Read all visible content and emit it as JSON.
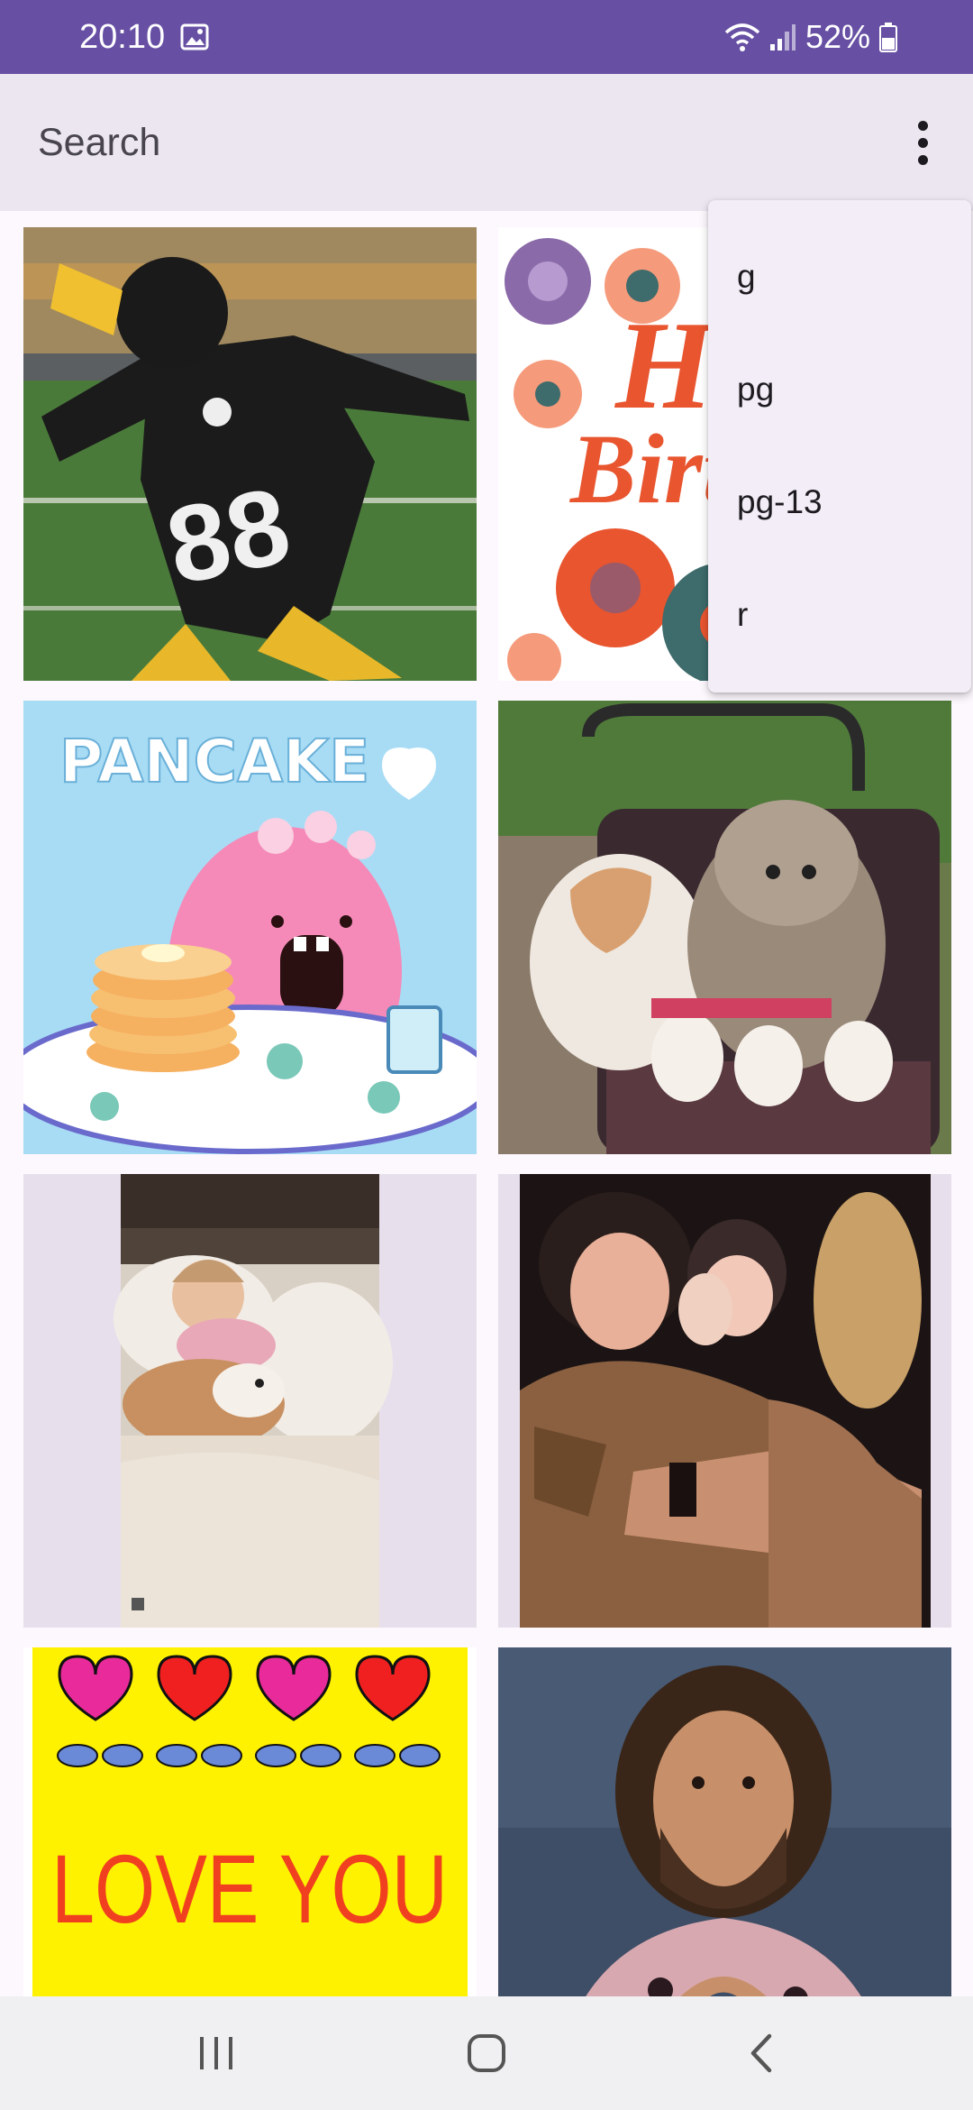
{
  "status_bar": {
    "time": "20:10",
    "battery": "52%",
    "background": "#6750a4",
    "icons": [
      "gallery-icon",
      "wifi-icon",
      "signal-icon",
      "battery-icon"
    ]
  },
  "search": {
    "placeholder": "Search",
    "value": "",
    "menu_icon": "more-vert-icon"
  },
  "rating_menu": {
    "items": [
      {
        "label": "g"
      },
      {
        "label": "pg"
      },
      {
        "label": "pg-13"
      },
      {
        "label": "r"
      }
    ]
  },
  "gif_grid": {
    "items": [
      {
        "subject": "football player dabbing"
      },
      {
        "subject": "happy birthday flowers"
      },
      {
        "subject": "pancake monster"
      },
      {
        "subject": "two cats in stroller"
      },
      {
        "subject": "child hugging dog"
      },
      {
        "subject": "woman waving"
      },
      {
        "subject": "love you hearts",
        "text": "LOVE YOU"
      },
      {
        "subject": "man making heart hands"
      }
    ],
    "sticker_texts": {
      "birthday_1": "Ha",
      "birthday_2": "Birth",
      "pancake": "PANCAKE"
    }
  },
  "nav_bar": {
    "buttons": [
      "recents-icon",
      "home-icon",
      "back-icon"
    ]
  }
}
